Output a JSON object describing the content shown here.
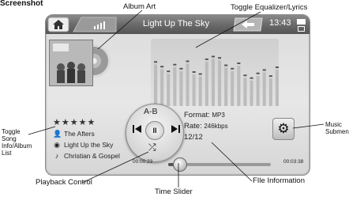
{
  "screenshot_label": "Screenshot",
  "callouts": {
    "album_art": "Album Art",
    "toggle_eq": "Toggle Equalizer/Lyrics",
    "toggle_info_lines": [
      "Toggle",
      "Song",
      "Info/Album",
      "List"
    ],
    "music_submenu_lines": [
      "Music",
      "Submenu"
    ],
    "playback_control": "Playback Control",
    "file_information": "FIle Information",
    "time_slider": "Time Slider"
  },
  "topbar": {
    "title": "Light Up The Sky",
    "clock": "13:43"
  },
  "song": {
    "rating": 5,
    "stars": "★★★★★",
    "artist": "The Afters",
    "album": "Light Up the Sky",
    "genre": "Christian & Gospel"
  },
  "playback": {
    "ab_label": "A-B",
    "prev_icon": "⏮",
    "play_pause_icon": "II",
    "next_icon": "⏭",
    "shuffle_icon": "⤮"
  },
  "file_info": {
    "format_label": "Format:",
    "format_value": "MP3",
    "rate_label": "Rate:",
    "rate_value": "246kbps",
    "track": "12/12"
  },
  "time": {
    "elapsed": "00:00:23",
    "total": "00:03:38",
    "progress_fraction": 0.11
  },
  "icons": {
    "home": "home-icon",
    "signal": "signal-icon",
    "back": "back-arrow-icon",
    "battery": "battery-icon",
    "gear": "gear-icon",
    "artist": "person-icon",
    "album": "disc-icon",
    "genre": "guitar-icon"
  },
  "colors": {
    "screen_bg": "#e1e1e1",
    "topbar": "#6a6a6a",
    "text_dark": "#222222"
  }
}
